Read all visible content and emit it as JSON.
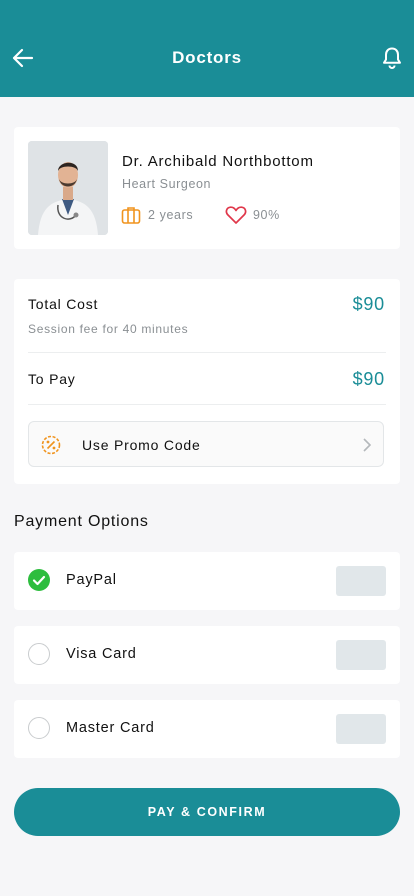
{
  "header": {
    "title": "Doctors",
    "back_icon": "arrow-left-icon",
    "notification_icon": "bell-icon"
  },
  "doctor": {
    "name": "Dr. Archibald Northbottom",
    "specialty": "Heart Surgeon",
    "experience": "2 years",
    "rating": "90%",
    "experience_icon": "briefcase-icon",
    "rating_icon": "heart-icon"
  },
  "cost": {
    "total_label": "Total Cost",
    "total_value": "$90",
    "session_note": "Session fee for 40 minutes",
    "to_pay_label": "To Pay",
    "to_pay_value": "$90",
    "promo_label": "Use Promo Code",
    "promo_icon": "percent-badge-icon"
  },
  "payment": {
    "section_title": "Payment Options",
    "options": [
      {
        "label": "PayPal",
        "selected": true
      },
      {
        "label": "Visa Card",
        "selected": false
      },
      {
        "label": "Master Card",
        "selected": false
      }
    ]
  },
  "action": {
    "confirm_label": "PAY & CONFIRM"
  },
  "colors": {
    "primary": "#1a8d97",
    "accent_orange": "#f0941e",
    "heart_red": "#e0374a",
    "check_green": "#2dbd3e"
  }
}
